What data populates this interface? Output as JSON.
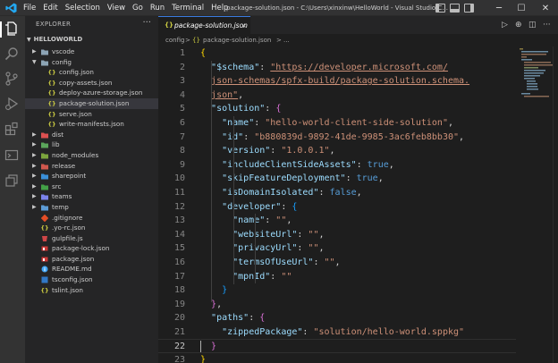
{
  "titlebar": {
    "menu": [
      "File",
      "Edit",
      "Selection",
      "View",
      "Go",
      "Run",
      "Terminal",
      "Help"
    ],
    "title": "package-solution.json - C:\\Users\\xinxinw\\HelloWorld - Visual Studio C...",
    "controls": {
      "minimize": "─",
      "maximize": "☐",
      "close": "✕"
    }
  },
  "activity_bar": [
    "files-icon",
    "search-icon",
    "source-control-icon",
    "run-debug-icon",
    "extensions-icon",
    "remote-explorer-icon",
    "layers-icon"
  ],
  "explorer": {
    "header": "EXPLORER",
    "more": "···",
    "section": "HELLOWORLD",
    "items": [
      {
        "label": "vscode",
        "icon": "folder",
        "color": "#8da4b5",
        "expanded": false,
        "depth": 0
      },
      {
        "label": "config",
        "icon": "folder",
        "color": "#8da4b5",
        "expanded": true,
        "depth": 0
      },
      {
        "label": "config.json",
        "icon": "json",
        "depth": 1
      },
      {
        "label": "copy-assets.json",
        "icon": "json",
        "depth": 1
      },
      {
        "label": "deploy-azure-storage.json",
        "icon": "json",
        "depth": 1
      },
      {
        "label": "package-solution.json",
        "icon": "json",
        "depth": 1,
        "active": true
      },
      {
        "label": "serve.json",
        "icon": "json",
        "depth": 1
      },
      {
        "label": "write-manifests.json",
        "icon": "json",
        "depth": 1
      },
      {
        "label": "dist",
        "icon": "folder",
        "color": "#dc5050",
        "expanded": false,
        "depth": 0
      },
      {
        "label": "lib",
        "icon": "folder",
        "color": "#5ba65b",
        "expanded": false,
        "depth": 0
      },
      {
        "label": "node_modules",
        "icon": "folder",
        "color": "#7ca53d",
        "expanded": false,
        "depth": 0
      },
      {
        "label": "release",
        "icon": "folder",
        "color": "#d0574d",
        "expanded": false,
        "depth": 0
      },
      {
        "label": "sharepoint",
        "icon": "folder",
        "color": "#3a8fd8",
        "expanded": false,
        "depth": 0
      },
      {
        "label": "src",
        "icon": "folder",
        "color": "#43a047",
        "expanded": false,
        "depth": 0
      },
      {
        "label": "teams",
        "icon": "folder",
        "color": "#7b83eb",
        "expanded": false,
        "depth": 0
      },
      {
        "label": "temp",
        "icon": "folder",
        "color": "#5c9bd5",
        "expanded": false,
        "depth": 0
      },
      {
        "label": ".gitignore",
        "icon": "git",
        "depth": 0
      },
      {
        "label": ".yo-rc.json",
        "icon": "json",
        "depth": 0
      },
      {
        "label": "gulpfile.js",
        "icon": "gulp",
        "depth": 0
      },
      {
        "label": "package-lock.json",
        "icon": "npm",
        "depth": 0
      },
      {
        "label": "package.json",
        "icon": "npm",
        "depth": 0
      },
      {
        "label": "README.md",
        "icon": "info",
        "depth": 0
      },
      {
        "label": "tsconfig.json",
        "icon": "tsconfig",
        "depth": 0
      },
      {
        "label": "tslint.json",
        "icon": "json",
        "depth": 0
      }
    ]
  },
  "editor": {
    "tab": {
      "label": "package-solution.json",
      "icon": "{}",
      "close": "×"
    },
    "breadcrumb": [
      "config",
      ">",
      "{}",
      "package-solution.json",
      ">",
      "..."
    ],
    "cursor_line": 22
  },
  "code": [
    [
      [
        "b1",
        "{"
      ]
    ],
    [
      [
        "p",
        "  "
      ],
      [
        "k",
        "\"$schema\""
      ],
      [
        "p",
        ": "
      ],
      [
        "u",
        "\"https://developer.microsoft.com/"
      ]
    ],
    [
      [
        "p",
        "  "
      ],
      [
        "u",
        "json-schemas/spfx-build/package-solution.schema."
      ]
    ],
    [
      [
        "p",
        "  "
      ],
      [
        "u",
        "json\""
      ],
      [
        "p",
        ","
      ]
    ],
    [
      [
        "p",
        "  "
      ],
      [
        "k",
        "\"solution\""
      ],
      [
        "p",
        ": "
      ],
      [
        "b2",
        "{"
      ]
    ],
    [
      [
        "p",
        "    "
      ],
      [
        "k",
        "\"name\""
      ],
      [
        "p",
        ": "
      ],
      [
        "s",
        "\"hello-world-client-side-solution\""
      ],
      [
        "p",
        ","
      ]
    ],
    [
      [
        "p",
        "    "
      ],
      [
        "k",
        "\"id\""
      ],
      [
        "p",
        ": "
      ],
      [
        "s",
        "\"b880839d-9892-41de-9985-3ac6feb8bb30\""
      ],
      [
        "p",
        ","
      ]
    ],
    [
      [
        "p",
        "    "
      ],
      [
        "k",
        "\"version\""
      ],
      [
        "p",
        ": "
      ],
      [
        "s",
        "\"1.0.0.1\""
      ],
      [
        "p",
        ","
      ]
    ],
    [
      [
        "p",
        "    "
      ],
      [
        "k",
        "\"includeClientSideAssets\""
      ],
      [
        "p",
        ": "
      ],
      [
        "b",
        "true"
      ],
      [
        "p",
        ","
      ]
    ],
    [
      [
        "p",
        "    "
      ],
      [
        "k",
        "\"skipFeatureDeployment\""
      ],
      [
        "p",
        ": "
      ],
      [
        "b",
        "true"
      ],
      [
        "p",
        ","
      ]
    ],
    [
      [
        "p",
        "    "
      ],
      [
        "k",
        "\"isDomainIsolated\""
      ],
      [
        "p",
        ": "
      ],
      [
        "b",
        "false"
      ],
      [
        "p",
        ","
      ]
    ],
    [
      [
        "p",
        "    "
      ],
      [
        "k",
        "\"developer\""
      ],
      [
        "p",
        ": "
      ],
      [
        "b3",
        "{"
      ]
    ],
    [
      [
        "p",
        "      "
      ],
      [
        "k",
        "\"name\""
      ],
      [
        "p",
        ": "
      ],
      [
        "s",
        "\"\""
      ],
      [
        "p",
        ","
      ]
    ],
    [
      [
        "p",
        "      "
      ],
      [
        "k",
        "\"websiteUrl\""
      ],
      [
        "p",
        ": "
      ],
      [
        "s",
        "\"\""
      ],
      [
        "p",
        ","
      ]
    ],
    [
      [
        "p",
        "      "
      ],
      [
        "k",
        "\"privacyUrl\""
      ],
      [
        "p",
        ": "
      ],
      [
        "s",
        "\"\""
      ],
      [
        "p",
        ","
      ]
    ],
    [
      [
        "p",
        "      "
      ],
      [
        "k",
        "\"termsOfUseUrl\""
      ],
      [
        "p",
        ": "
      ],
      [
        "s",
        "\"\""
      ],
      [
        "p",
        ","
      ]
    ],
    [
      [
        "p",
        "      "
      ],
      [
        "k",
        "\"mpnId\""
      ],
      [
        "p",
        ": "
      ],
      [
        "s",
        "\"\""
      ]
    ],
    [
      [
        "p",
        "    "
      ],
      [
        "b3",
        "}"
      ]
    ],
    [
      [
        "p",
        "  "
      ],
      [
        "b2",
        "}"
      ],
      [
        "p",
        ","
      ]
    ],
    [
      [
        "p",
        "  "
      ],
      [
        "k",
        "\"paths\""
      ],
      [
        "p",
        ": "
      ],
      [
        "b2",
        "{"
      ]
    ],
    [
      [
        "p",
        "    "
      ],
      [
        "k",
        "\"zippedPackage\""
      ],
      [
        "p",
        ": "
      ],
      [
        "s",
        "\"solution/hello-world.sppkg\""
      ]
    ],
    [
      [
        "p",
        "  "
      ],
      [
        "b2",
        "}"
      ]
    ],
    [
      [
        "b1",
        "}"
      ]
    ],
    []
  ],
  "colors": {
    "accent": "#007acc",
    "activity_bg": "#333333",
    "sidebar_bg": "#252526",
    "editor_bg": "#1e1e1e",
    "key": "#9cdcfe",
    "string": "#ce9178",
    "keyword": "#569cd6"
  }
}
